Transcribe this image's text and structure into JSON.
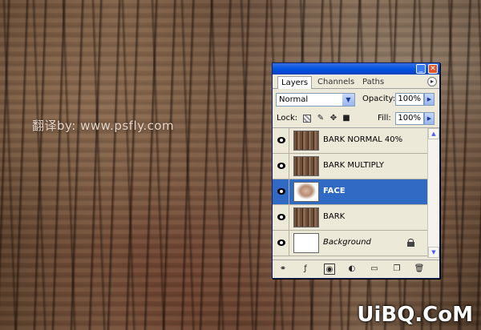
{
  "watermarks": {
    "chinese_credit": "翻译by: www.psfly.com",
    "logo": "UiBQ.CoM"
  },
  "palette": {
    "title_buttons": {
      "minimize": "_",
      "close": "✕"
    },
    "tabs": [
      {
        "label": "Layers",
        "active": true
      },
      {
        "label": "Channels",
        "active": false
      },
      {
        "label": "Paths",
        "active": false
      }
    ],
    "menu_icon": "▸",
    "blend_mode": "Normal",
    "opacity_label": "Opacity:",
    "opacity_value": "100%",
    "lock_label": "Lock:",
    "fill_label": "Fill:",
    "fill_value": "100%",
    "layers": [
      {
        "name": "BARK NORMAL 40%",
        "thumb": "bark",
        "visible": true,
        "selected": false,
        "italic": false,
        "locked": false
      },
      {
        "name": "BARK MULTIPLY",
        "thumb": "bark",
        "visible": true,
        "selected": false,
        "italic": false,
        "locked": false
      },
      {
        "name": "FACE",
        "thumb": "face",
        "visible": true,
        "selected": true,
        "italic": false,
        "locked": false
      },
      {
        "name": "BARK",
        "thumb": "bark",
        "visible": true,
        "selected": false,
        "italic": false,
        "locked": false
      },
      {
        "name": "Background",
        "thumb": "white",
        "visible": true,
        "selected": false,
        "italic": true,
        "locked": true
      }
    ],
    "selection_color": "#316ac5"
  }
}
